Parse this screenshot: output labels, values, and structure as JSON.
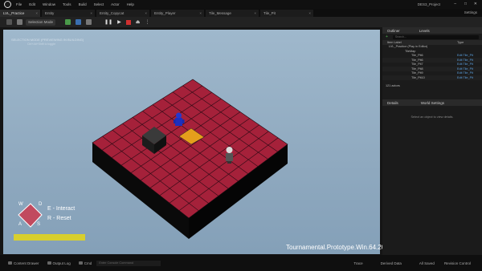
{
  "menubar": {
    "items": [
      "File",
      "Edit",
      "Window",
      "Tools",
      "Build",
      "Select",
      "Actor",
      "Help"
    ],
    "project": "DES3_Project"
  },
  "tabs": [
    {
      "label": "LVL_Practice",
      "active": true
    },
    {
      "label": "Entity"
    },
    {
      "label": "Entity_Copycat"
    },
    {
      "label": "Entity_Player"
    },
    {
      "label": "Tile_Message"
    },
    {
      "label": "Tile_Pit"
    }
  ],
  "tabbar": {
    "settings": "Settings"
  },
  "toolbar": {
    "selection_mode": "Selection Mode"
  },
  "viewport": {
    "info_line1": "SELECTION MODE (PREVIEWING IN BUILDING)",
    "info_line2": "Ctrl+Alt+Shift to toggle",
    "legend_interact": "E - Interact",
    "legend_reset": "R - Reset",
    "keys": {
      "w": "W",
      "a": "A",
      "s": "S",
      "d": "D"
    },
    "build_label": "Tournamental.Prototype.Win.64.2024",
    "colors": {
      "tile": "#a5213a",
      "goal": "#e59e1c",
      "player": "#1e2fbd",
      "block": "#2a2a2a",
      "hp": "#d8cf2e"
    }
  },
  "outliner": {
    "tab_outliner": "Outliner",
    "tab_levels": "Levels",
    "search_placeholder": "Search...",
    "col_label": "Item Label",
    "col_type": "Type",
    "root": "LVL_Practice (Play in Editor)",
    "folder": "TileMap",
    "rows": [
      {
        "name": "Tile_Pit6",
        "type": "Edit Tile_Pit"
      },
      {
        "name": "Tile_Pit6",
        "type": "Edit Tile_Pit"
      },
      {
        "name": "Tile_Pit7",
        "type": "Edit Tile_Pit"
      },
      {
        "name": "Tile_Pit8",
        "type": "Edit Tile_Pit"
      },
      {
        "name": "Tile_Pit9",
        "type": "Edit Tile_Pit"
      },
      {
        "name": "Tile_Pit10",
        "type": "Edit Tile_Pit"
      }
    ],
    "count": "121 actors"
  },
  "details": {
    "tab_details": "Details",
    "tab_world": "World Settings",
    "empty": "Select an object to view details."
  },
  "statusbar": {
    "content_drawer": "Content Drawer",
    "output_log": "Output Log",
    "cmd": "Cmd",
    "cmd_placeholder": "Enter Console Command",
    "trace": "Trace",
    "derived": "Derived Data",
    "saved": "All Saved",
    "revision": "Revision Control"
  }
}
